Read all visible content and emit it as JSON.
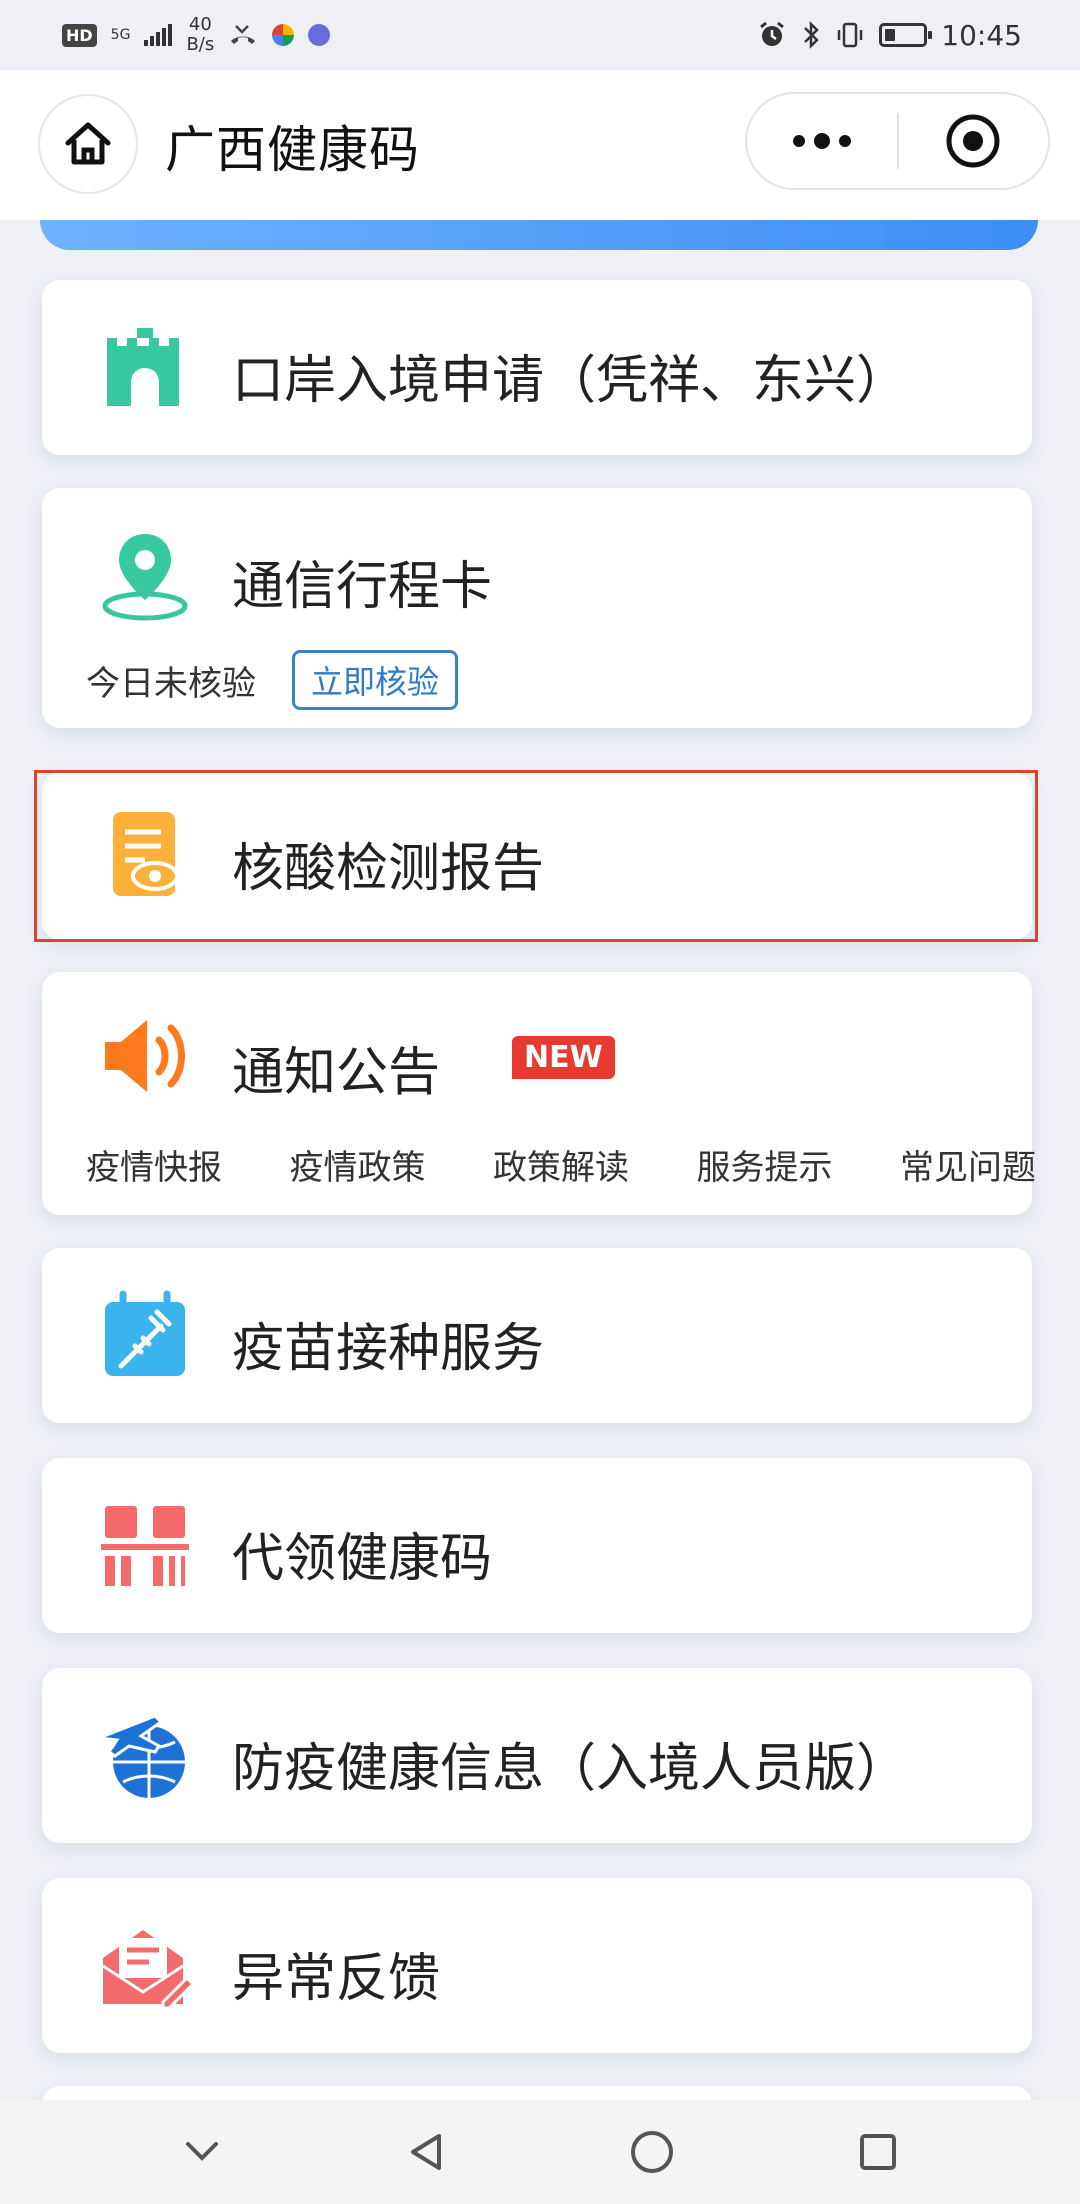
{
  "status_bar": {
    "hd": "HD",
    "net_type": "5G",
    "speed_value": "40",
    "speed_unit": "B/s",
    "time": "10:45"
  },
  "nav": {
    "title": "广西健康码"
  },
  "cards": [
    {
      "label": "口岸入境申请（凭祥、东兴）",
      "icon": "gate-icon"
    },
    {
      "label": "通信行程卡",
      "icon": "location-pin-icon",
      "sub_text": "今日未核验",
      "action_label": "立即核验"
    },
    {
      "label": "核酸检测报告",
      "icon": "report-eye-icon",
      "selected": true
    },
    {
      "label": "通知公告",
      "icon": "speaker-icon",
      "badge": "NEW",
      "items": [
        "疫情快报",
        "疫情政策",
        "政策解读",
        "服务提示",
        "常见问题"
      ]
    },
    {
      "label": "疫苗接种服务",
      "icon": "vaccine-calendar-icon"
    },
    {
      "label": "代领健康码",
      "icon": "qr-code-icon"
    },
    {
      "label": "防疫健康信息（入境人员版）",
      "icon": "plane-globe-icon"
    },
    {
      "label": "异常反馈",
      "icon": "feedback-envelope-icon"
    }
  ],
  "colors": {
    "selected_border": "#d9472b",
    "accent_blue": "#3d82c9",
    "badge_red": "#e93a32"
  }
}
